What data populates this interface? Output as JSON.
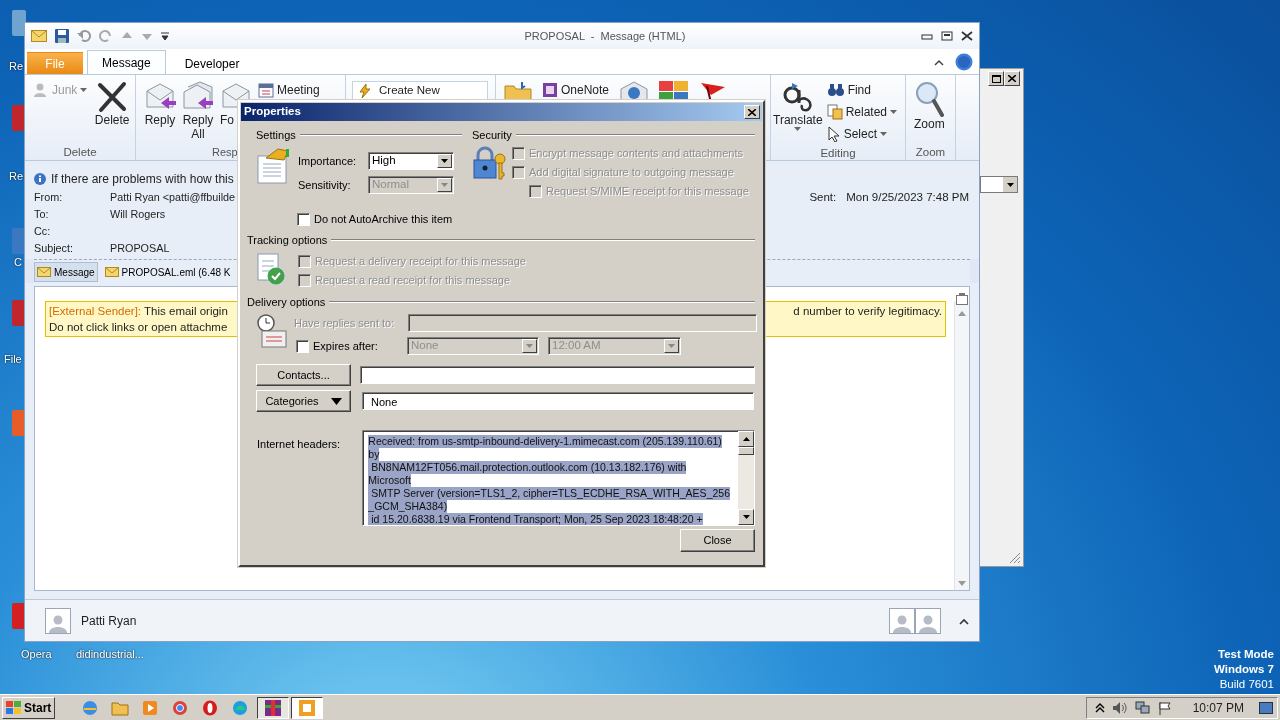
{
  "desktop": {
    "icons": [
      {
        "label": "Re"
      },
      {
        "label": "Re"
      },
      {
        "label": "C"
      },
      {
        "label": "File"
      },
      {
        "label": "Opera"
      },
      {
        "label": "didindustrial..."
      }
    ],
    "os_notice": [
      "Test Mode",
      "Windows 7",
      "Build 7601"
    ]
  },
  "window": {
    "title": "PROPOSAL  -  Message (HTML)",
    "tabs": [
      {
        "label": "File",
        "kind": "file",
        "selected": false
      },
      {
        "label": "Message",
        "kind": "tab",
        "selected": true
      },
      {
        "label": "Developer",
        "kind": "tab",
        "selected": false
      }
    ],
    "ribbon": {
      "groups": [
        {
          "label": "Delete",
          "items": [
            {
              "kind": "small",
              "label": "Junk",
              "disabled": true,
              "menu": true
            },
            {
              "kind": "large",
              "label": "Delete"
            }
          ]
        },
        {
          "label": "Resp",
          "items": [
            {
              "kind": "large",
              "label": "Reply"
            },
            {
              "kind": "large",
              "label": "Reply All"
            },
            {
              "kind": "large",
              "label": "Fo"
            },
            {
              "kind": "small",
              "label": "Meeting"
            }
          ]
        },
        {
          "items": [
            {
              "kind": "gallery",
              "label": "Create New"
            }
          ]
        },
        {
          "items": [
            {
              "kind": "icon"
            },
            {
              "kind": "small",
              "label": "OneNote"
            },
            {
              "kind": "icon"
            },
            {
              "kind": "icon"
            },
            {
              "kind": "icon"
            }
          ]
        },
        {
          "label": "Editing",
          "items": [
            {
              "kind": "large",
              "label": "Translate",
              "menu": true
            },
            {
              "kind": "small",
              "label": "Find"
            },
            {
              "kind": "small",
              "label": "Related",
              "menu": true
            },
            {
              "kind": "small",
              "label": "Select",
              "menu": true
            }
          ]
        },
        {
          "label": "Zoom",
          "items": [
            {
              "kind": "large",
              "label": "Zoom"
            }
          ]
        }
      ]
    },
    "info_bar": "If there are problems with how this",
    "fields": [
      {
        "label": "From:",
        "value": "Patti Ryan <patti@ffbuilde"
      },
      {
        "label": "To:",
        "value": "Will Rogers"
      },
      {
        "label": "Cc:"
      },
      {
        "label": "Subject:",
        "value": "PROPOSAL"
      }
    ],
    "sent": {
      "label": "Sent:",
      "value": "Mon 9/25/2023 7:48 PM"
    },
    "attachments": [
      {
        "label": "Message",
        "selected": true
      },
      {
        "label": "PROPOSAL.eml (6.48 K",
        "selected": false
      }
    ],
    "banner": {
      "tag": "[External Sender]:",
      "line1": "This email origin",
      "line1_end": "d number to verify legitimacy.",
      "line2": "Do not click links or open attachme"
    },
    "people_pane": {
      "name": "Patti Ryan"
    }
  },
  "dialog": {
    "title": "Properties",
    "settings": {
      "heading": "Settings",
      "importance": {
        "label": "Importance:",
        "value": "High",
        "disabled": false
      },
      "sensitivity": {
        "label": "Sensitivity:",
        "value": "Normal",
        "disabled": true
      },
      "autoarchive": {
        "label": "Do not AutoArchive this item",
        "checked": false,
        "disabled": false
      }
    },
    "security": {
      "heading": "Security",
      "options": [
        {
          "kind": "option",
          "label": "Encrypt message contents and attachments",
          "checked": false,
          "disabled": true
        },
        {
          "kind": "option",
          "label": "Add digital signature to outgoing message",
          "checked": false,
          "disabled": true
        },
        {
          "kind": "sub-option",
          "label": "Request S/MIME receipt for this message",
          "checked": false,
          "disabled": true
        }
      ]
    },
    "tracking": {
      "heading": "Tracking options",
      "options": [
        {
          "label": "Request a delivery receipt for this message",
          "checked": false,
          "disabled": true
        },
        {
          "label": "Request a read receipt for this message",
          "checked": false,
          "disabled": true
        }
      ]
    },
    "delivery": {
      "heading": "Delivery options",
      "replies": {
        "label": "Have replies sent to:",
        "disabled": true
      },
      "expires": {
        "label": "Expires after:",
        "checked": false,
        "date": "None",
        "time": "12:00 AM",
        "disabled": true
      }
    },
    "contacts": {
      "button": "Contacts..."
    },
    "categories": {
      "button": "Categories",
      "value": "None"
    },
    "headers": {
      "label": "Internet headers:",
      "lines": [
        "Received: from us-smtp-inbound-delivery-1.mimecast.com (205.139.110.61)",
        "by",
        " BN8NAM12FT056.mail.protection.outlook.com (10.13.182.176) with",
        "Microsoft",
        " SMTP Server (version=TLS1_2, cipher=TLS_ECDHE_RSA_WITH_AES_256",
        "_GCM_SHA384)",
        " id 15.20.6838.19 via Frontend Transport; Mon, 25 Sep 2023 18:48:20 +"
      ]
    },
    "close": "Close"
  },
  "taskbar": {
    "start": "Start",
    "clock": "10:07 PM"
  }
}
